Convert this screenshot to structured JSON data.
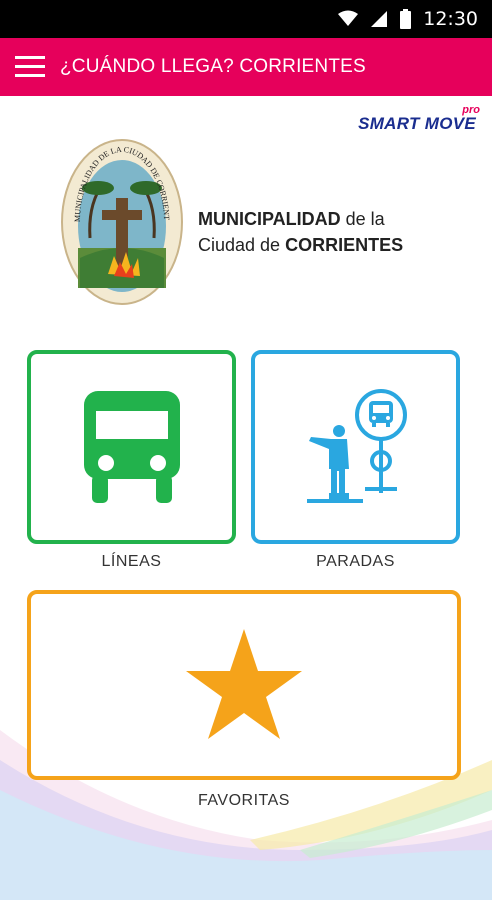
{
  "status_bar": {
    "time": "12:30",
    "icons": [
      "wifi-icon",
      "signal-icon",
      "battery-icon"
    ]
  },
  "app_bar": {
    "title": "¿CUÁNDO LLEGA? CORRIENTES",
    "background": "#e6005b"
  },
  "brand": {
    "name": "SMART MOVE",
    "tag": "pro",
    "color": "#1a2d8f"
  },
  "crest": {
    "text": "MUNICIPALIDAD DE LA CIUDAD DE CORRIENTES"
  },
  "municipality": {
    "line1_bold": "MUNICIPALIDAD",
    "line1_rest": " de la",
    "line2_rest": "Ciudad de ",
    "line2_bold": "CORRIENTES"
  },
  "menu": {
    "lineas": {
      "label": "LÍNEAS",
      "color": "#22b24c",
      "icon": "bus-icon"
    },
    "paradas": {
      "label": "PARADAS",
      "color": "#2aa7e0",
      "icon": "bus-stop-icon"
    },
    "favoritas": {
      "label": "FAVORITAS",
      "color": "#f5a31a",
      "icon": "star-icon"
    }
  }
}
